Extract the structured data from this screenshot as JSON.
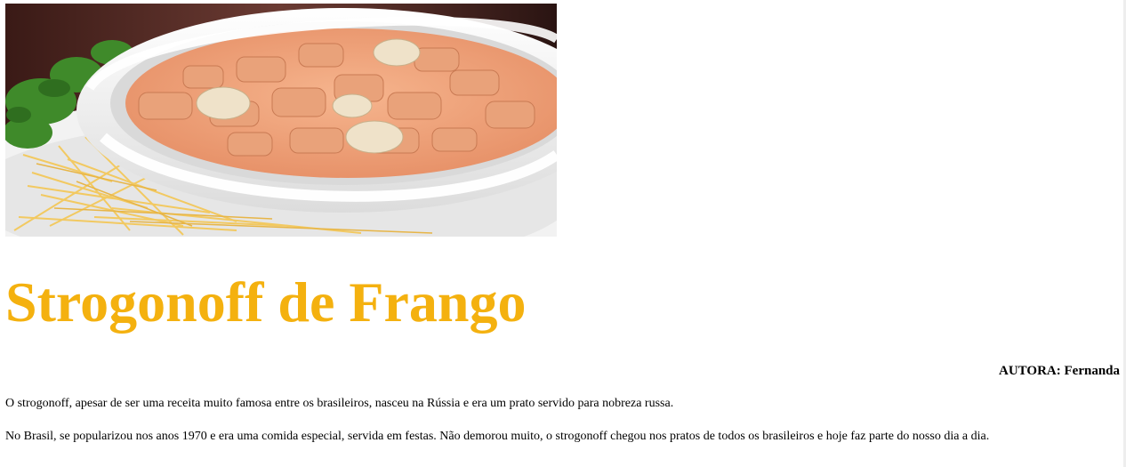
{
  "hero_image": {
    "subject": "strogonoff de frango servido com batata palha"
  },
  "article": {
    "title": "Strogonoff de Frango",
    "author": "AUTORA: Fernanda",
    "paragraphs": [
      "O strogonoff, apesar de ser uma receita muito famosa entre os brasileiros, nasceu na Rússia e era um prato servido para nobreza russa.",
      "No Brasil, se popularizou nos anos 1970 e era uma comida especial, servida em festas. Não demorou muito, o strogonoff chegou nos pratos de todos os brasileiros e hoje faz parte do nosso dia a dia."
    ]
  },
  "colors": {
    "title": "#f4b10f",
    "text": "#000000",
    "background": "#ffffff"
  }
}
